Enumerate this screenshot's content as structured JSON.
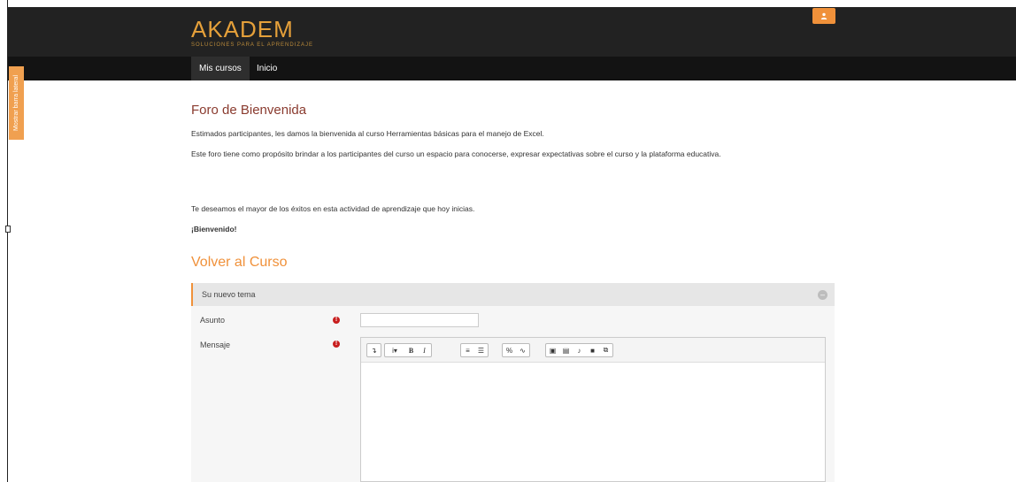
{
  "brand": {
    "logo_text": "AKADEM",
    "logo_tagline": "SOLUCIONES PARA EL APRENDIZAJE"
  },
  "nav": {
    "items": [
      {
        "label": "Mis cursos"
      },
      {
        "label": "Inicio"
      }
    ]
  },
  "sidebar_toggle": {
    "label": "Mostrar barra lateral"
  },
  "forum": {
    "title": "Foro de Bienvenida",
    "paragraphs": [
      "Estimados participantes, les damos la bienvenida al curso Herramientas básicas para el manejo de Excel.",
      "Este foro tiene como propósito brindar a los participantes del curso un espacio para conocerse, expresar expectativas sobre el curso y la plataforma educativa.",
      "Te deseamos el mayor de los éxitos en esta actividad de aprendizaje que hoy inicias."
    ],
    "closing": "¡Bienvenido!"
  },
  "back_link": {
    "label": "Volver al Curso"
  },
  "new_topic": {
    "section_title": "Su nuevo tema",
    "subject_label": "Asunto",
    "subject_value": "",
    "message_label": "Mensaje"
  },
  "colors": {
    "accent": "#f0913a",
    "header_bg": "#222222",
    "navbar_bg": "#131313",
    "title_color": "#8a3b2f",
    "required": "#c81e1e"
  },
  "toolbar_icons": [
    "toggle-toolbar-icon",
    "paragraph-style-icon",
    "bold-icon",
    "italic-icon",
    "unordered-list-icon",
    "ordered-list-icon",
    "link-icon",
    "unlink-icon",
    "image-icon",
    "media-icon",
    "record-audio-icon",
    "record-video-icon",
    "manage-files-icon"
  ]
}
